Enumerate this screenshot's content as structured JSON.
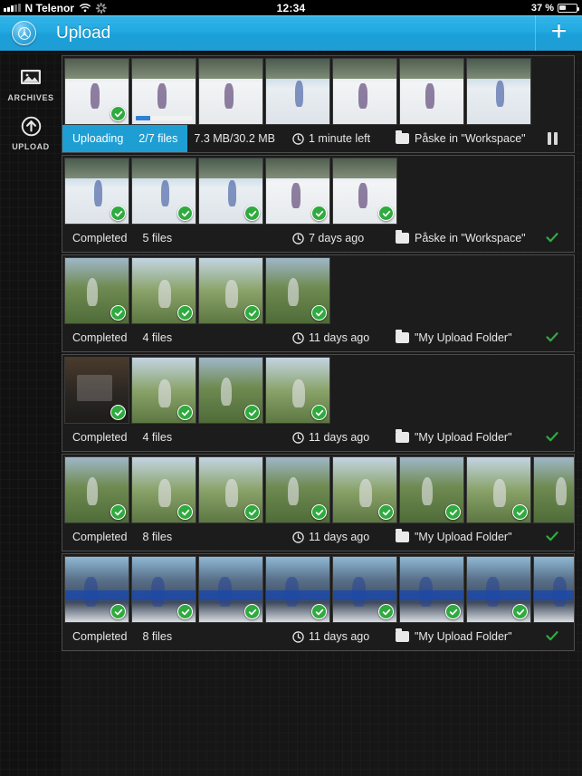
{
  "statusbar": {
    "carrier": "N Telenor",
    "time": "12:34",
    "battery_text": "37 %",
    "battery_level": 37,
    "signal_icon": "signal-bars-icon",
    "wifi_icon": "wifi-icon",
    "activity_icon": "activity-spinner-icon",
    "battery_icon": "battery-icon"
  },
  "navbar": {
    "title": "Upload",
    "logo_icon": "app-logo-icon",
    "add_label": "+",
    "add_icon": "plus-icon",
    "accent_color": "#1f9ed4"
  },
  "sidebar": {
    "items": [
      {
        "label": "ARCHIVES",
        "icon": "photo-archive-icon"
      },
      {
        "label": "UPLOAD",
        "icon": "upload-arrow-icon"
      }
    ]
  },
  "colors": {
    "accent": "#1f9ed4",
    "success": "#2faa3f",
    "progress": "#2f7fd4",
    "row_border": "#4c4c4c",
    "background": "#161616"
  },
  "uploads": [
    {
      "state": "Uploading",
      "files": "2/7 files",
      "size": "7.3 MB/30.2 MB",
      "time": "1 minute left",
      "folder": "Påske in \"Workspace\"",
      "active": true,
      "action_icon": "pause-icon",
      "thumb_count": 7,
      "thumbs": [
        {
          "style": "snow",
          "done": true,
          "progress": null
        },
        {
          "style": "snow",
          "done": false,
          "progress": 25
        },
        {
          "style": "snow",
          "done": false,
          "progress": null
        },
        {
          "style": "snow2",
          "done": false,
          "progress": null
        },
        {
          "style": "snow",
          "done": false,
          "progress": null
        },
        {
          "style": "snow",
          "done": false,
          "progress": null
        },
        {
          "style": "snow2",
          "done": false,
          "progress": null
        }
      ]
    },
    {
      "state": "Completed",
      "files": "5 files",
      "size": "",
      "time": "7 days ago",
      "folder": "Påske in \"Workspace\"",
      "active": false,
      "action_icon": "check-icon",
      "thumb_count": 5,
      "thumbs": [
        {
          "style": "snow2",
          "done": true,
          "progress": null
        },
        {
          "style": "snow2",
          "done": true,
          "progress": null
        },
        {
          "style": "snow2",
          "done": true,
          "progress": null
        },
        {
          "style": "snow",
          "done": true,
          "progress": null
        },
        {
          "style": "snow",
          "done": true,
          "progress": null
        }
      ]
    },
    {
      "state": "Completed",
      "files": "4 files",
      "size": "",
      "time": "11 days ago",
      "folder": "\"My Upload Folder\"",
      "active": false,
      "action_icon": "check-icon",
      "thumb_count": 4,
      "thumbs": [
        {
          "style": "green",
          "done": true,
          "progress": null
        },
        {
          "style": "green2",
          "done": true,
          "progress": null
        },
        {
          "style": "green2",
          "done": true,
          "progress": null
        },
        {
          "style": "green",
          "done": true,
          "progress": null
        }
      ]
    },
    {
      "state": "Completed",
      "files": "4 files",
      "size": "",
      "time": "11 days ago",
      "folder": "\"My Upload Folder\"",
      "active": false,
      "action_icon": "check-icon",
      "thumb_count": 4,
      "thumbs": [
        {
          "style": "dark",
          "done": true,
          "progress": null
        },
        {
          "style": "green2",
          "done": true,
          "progress": null
        },
        {
          "style": "green",
          "done": true,
          "progress": null
        },
        {
          "style": "green2",
          "done": true,
          "progress": null
        }
      ]
    },
    {
      "state": "Completed",
      "files": "8 files",
      "size": "",
      "time": "11 days ago",
      "folder": "\"My Upload Folder\"",
      "active": false,
      "action_icon": "check-icon",
      "thumb_count": 8,
      "thumbs": [
        {
          "style": "green",
          "done": true,
          "progress": null
        },
        {
          "style": "green2",
          "done": true,
          "progress": null
        },
        {
          "style": "green2",
          "done": true,
          "progress": null
        },
        {
          "style": "green",
          "done": true,
          "progress": null
        },
        {
          "style": "green2",
          "done": true,
          "progress": null
        },
        {
          "style": "green",
          "done": true,
          "progress": null
        },
        {
          "style": "green2",
          "done": true,
          "progress": null
        },
        {
          "style": "green",
          "done": true,
          "progress": null
        }
      ]
    },
    {
      "state": "Completed",
      "files": "8 files",
      "size": "",
      "time": "11 days ago",
      "folder": "\"My Upload Folder\"",
      "active": false,
      "action_icon": "check-icon",
      "thumb_count": 8,
      "thumbs": [
        {
          "style": "crowd",
          "done": true,
          "progress": null
        },
        {
          "style": "crowd",
          "done": true,
          "progress": null
        },
        {
          "style": "crowd",
          "done": true,
          "progress": null
        },
        {
          "style": "crowd",
          "done": true,
          "progress": null
        },
        {
          "style": "crowd",
          "done": true,
          "progress": null
        },
        {
          "style": "crowd",
          "done": true,
          "progress": null
        },
        {
          "style": "crowd",
          "done": true,
          "progress": null
        },
        {
          "style": "crowd",
          "done": true,
          "progress": null
        }
      ]
    }
  ]
}
